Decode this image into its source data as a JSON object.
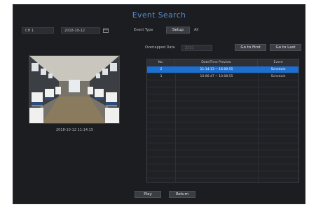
{
  "title": "Event Search",
  "channel": {
    "value": "CH 1"
  },
  "date": {
    "value": "2018-10-12",
    "icon": "calendar-icon"
  },
  "event_type": {
    "label": "Event Type",
    "setup_label": "Setup",
    "value": "All"
  },
  "overlapped": {
    "label": "Overlapped Data",
    "value": "Z021"
  },
  "nav": {
    "first_label": "Go to First",
    "last_label": "Go to Last"
  },
  "preview": {
    "timestamp": "2018-10-12 11:14:15"
  },
  "table": {
    "headers": [
      "No.",
      "Date/Time Preview",
      "Event"
    ],
    "rows": [
      {
        "no": "2",
        "time": "11:14:13 ~ 16:00:55",
        "event": "Schedule",
        "selected": true
      },
      {
        "no": "1",
        "time": "10:06:47 ~ 10:08:55",
        "event": "Schedule",
        "selected": false
      }
    ]
  },
  "footer": {
    "play_label": "Play",
    "return_label": "Return"
  }
}
